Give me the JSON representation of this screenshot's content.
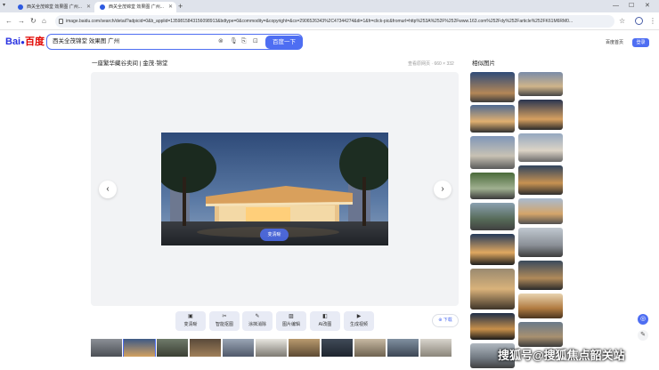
{
  "browser": {
    "tabs": [
      {
        "title": "西关全茂锦堂 效果图 广州...",
        "active": false
      },
      {
        "title": "西关全茂锦堂 效果图 广州...",
        "active": true
      }
    ],
    "new_tab": "+",
    "url": "image.baidu.com/search/detail?adpicid=0&b_applid=1359815843156098913&bdtype=0&commodity=&copyright=&cs=2906526343%2C47344274&di=1&fr=click-pic&fromurl=http%253A%252F%252Fwww.163.com%252Fdy%252Farticle%252FK61M6RM0..."
  },
  "header": {
    "logo_a": "Bai",
    "logo_paw": "●",
    "logo_b": "百度",
    "search_query": "西关全茂锦堂 效果图 广州",
    "search_button": "百度一下",
    "home_link": "百度首页",
    "login_button": "登录"
  },
  "main": {
    "title": "一座繁华藏谷卖间 | 金茂·锦堂",
    "source": "查看原网页 · 660 × 332",
    "hd_button": "变清晰",
    "download_button": "下载",
    "tools": [
      {
        "icon": "▣",
        "label": "变清晰"
      },
      {
        "icon": "✂",
        "label": "智能抠图"
      },
      {
        "icon": "✎",
        "label": "涂抹消除"
      },
      {
        "icon": "▨",
        "label": "图片编辑"
      },
      {
        "icon": "◧",
        "label": "AI改图"
      },
      {
        "icon": "▶",
        "label": "生成视频"
      }
    ]
  },
  "related": {
    "title": "相似图片"
  },
  "watermark": "搜狐号@搜狐焦点韶关站"
}
